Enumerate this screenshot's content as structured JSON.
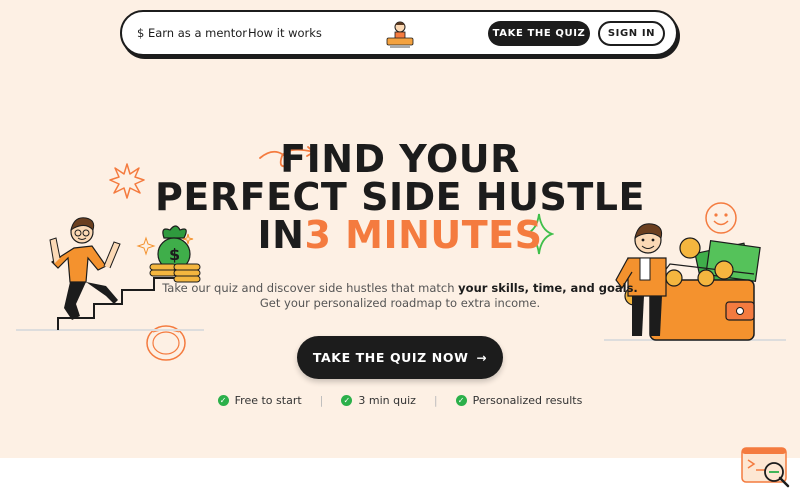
{
  "nav": {
    "earn_link": "$ Earn as a mentor",
    "how_link": "How it works",
    "logo_icon": "logo-mascot-icon",
    "quiz_button": "TAKE THE QUIZ",
    "signin_button": "SIGN IN"
  },
  "hero": {
    "line1": "FIND YOUR",
    "line2": "PERFECT SIDE HUSTLE",
    "line3_prefix": "IN",
    "line3_accent": "3 MINUTES",
    "sub_part1": "Take our quiz and discover side hustles that match ",
    "sub_bold": "your skills, time, and goals.",
    "sub_line2": "Get your personalized roadmap to extra income.",
    "cta": "TAKE THE QUIZ NOW",
    "cta_icon": "arrow-right-icon"
  },
  "features": [
    {
      "label": "Free to start"
    },
    {
      "label": "3 min quiz"
    },
    {
      "label": "Personalized results"
    }
  ],
  "colors": {
    "background": "#fdf0e4",
    "accent": "#f47b3f",
    "dark": "#1c1c1c",
    "check": "#2bb04a"
  }
}
